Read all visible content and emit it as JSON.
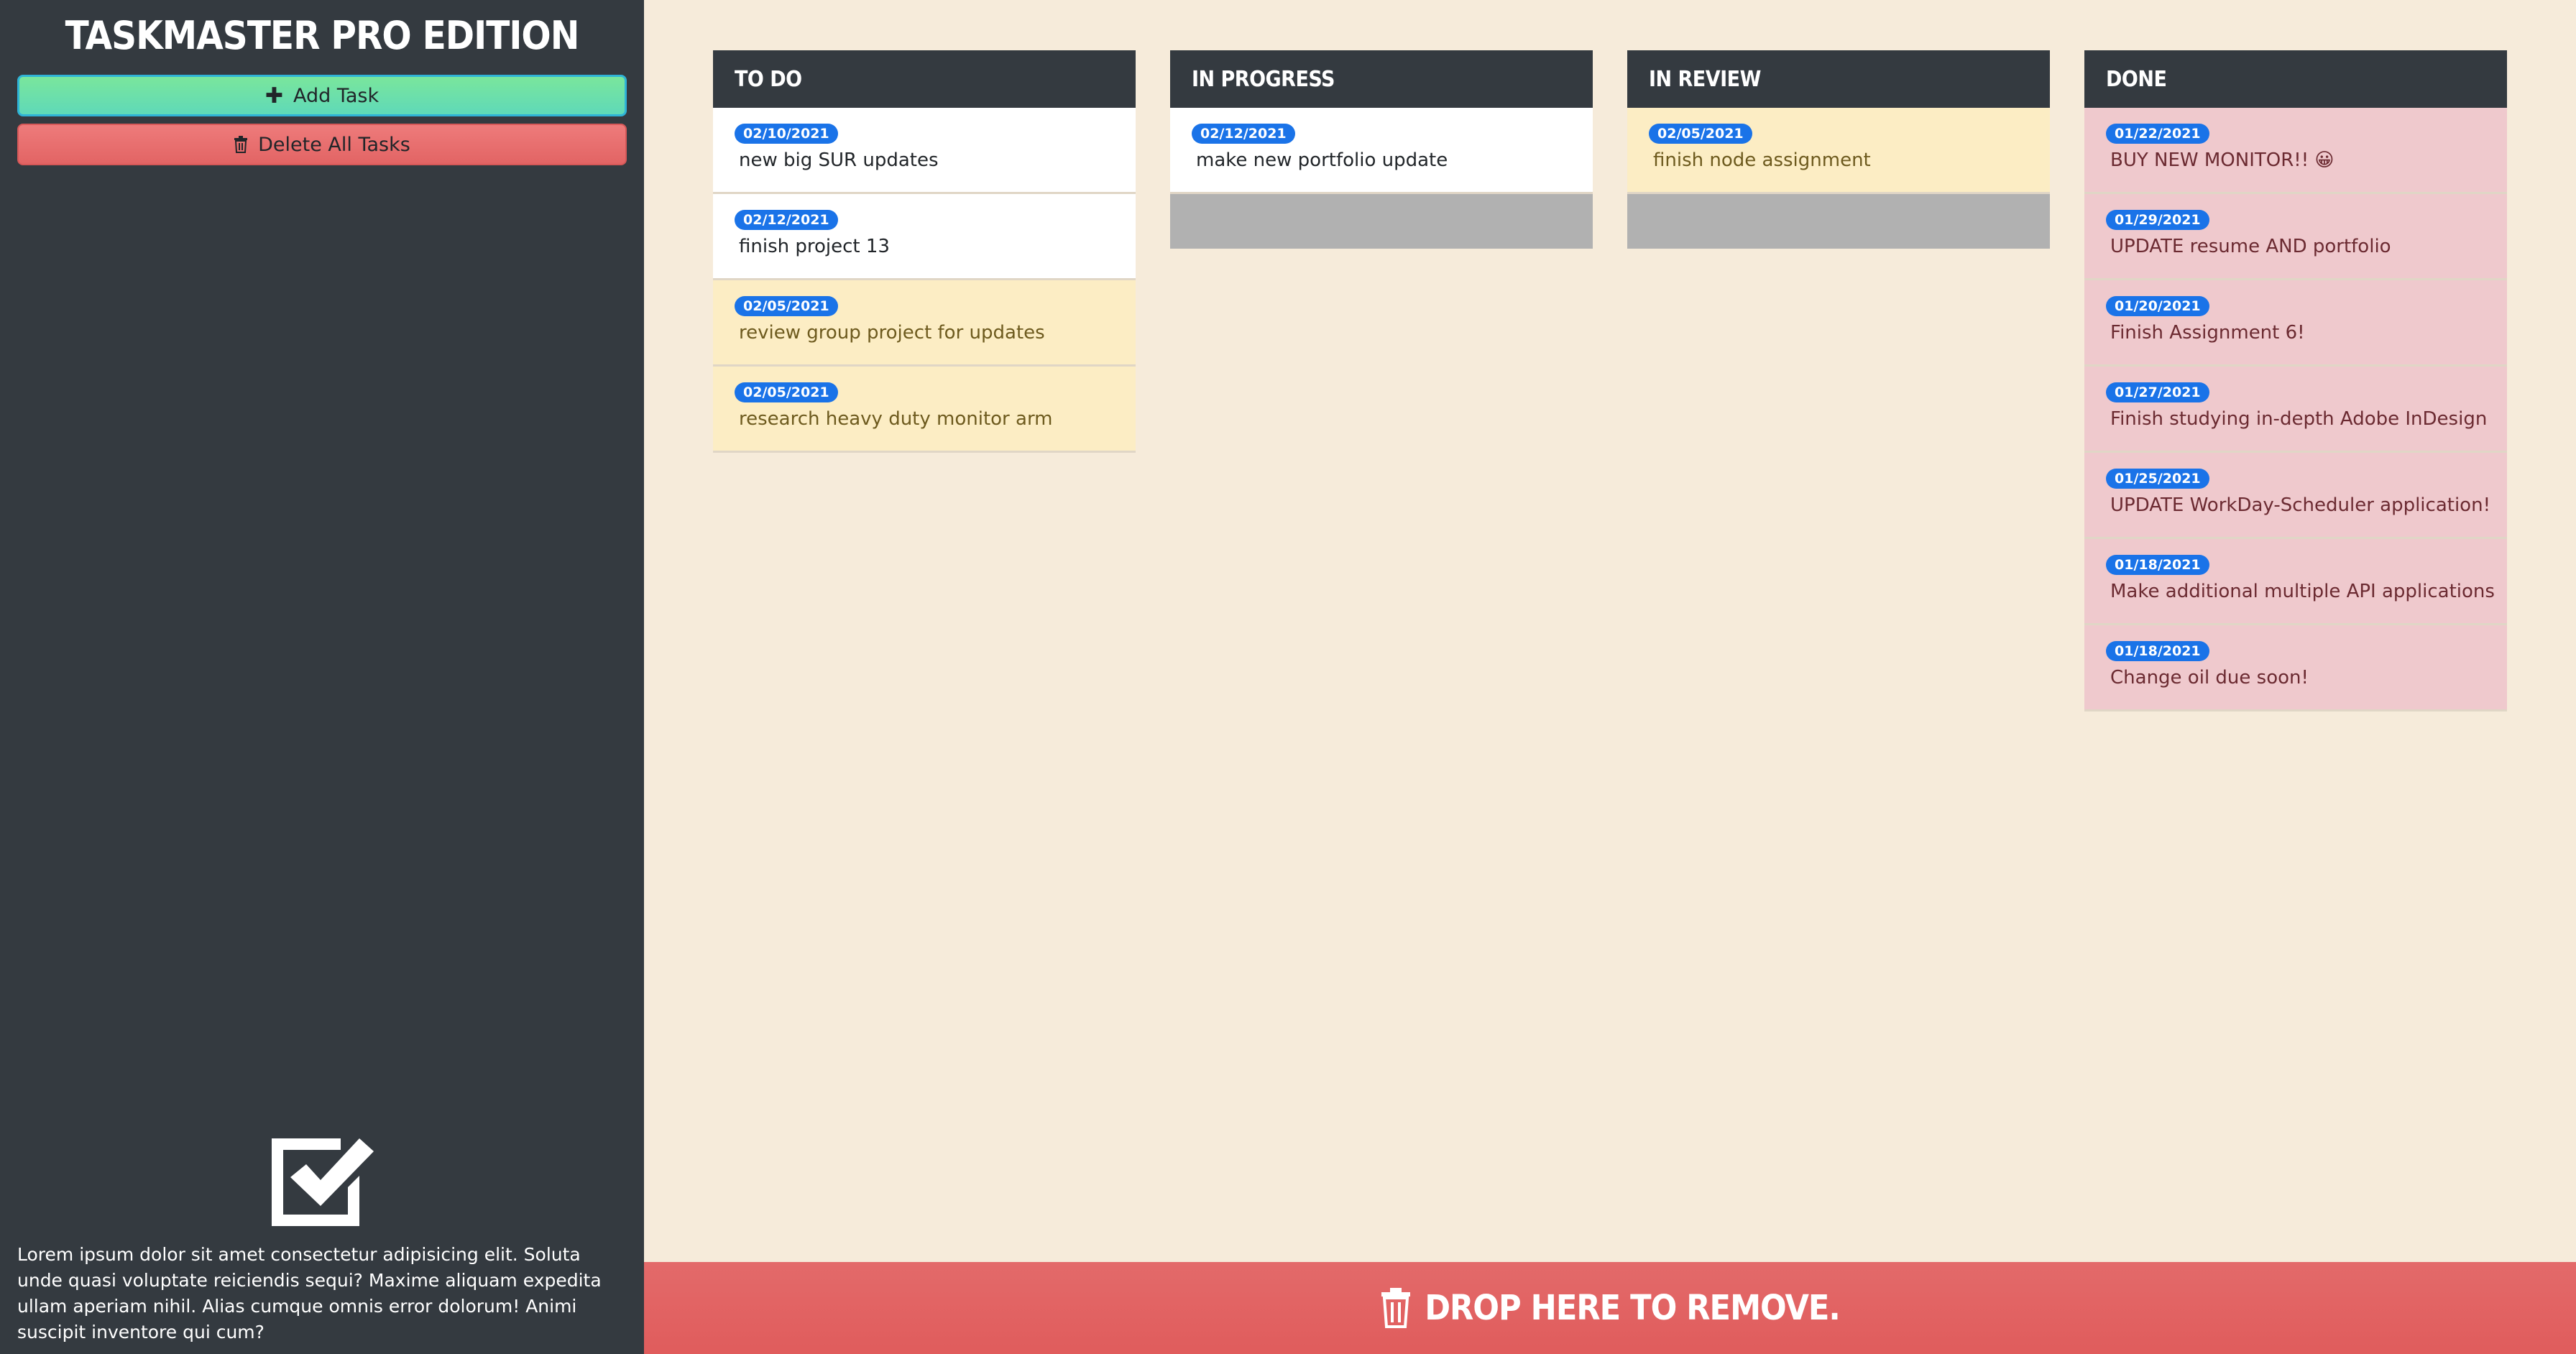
{
  "app": {
    "title": "TASKMASTER PRO EDITION",
    "add_label": "Add Task",
    "delete_label": "Delete All Tasks",
    "description": "Lorem ipsum dolor sit amet consectetur adipisicing elit. Soluta unde quasi voluptate reiciendis sequi? Maxime aliquam expedita ullam aperiam nihil. Alias cumque omnis error dolorum! Animi suscipit inventore qui cum?"
  },
  "icons": {
    "add": "plus-icon",
    "delete": "trash-icon",
    "logo": "check-square-icon",
    "drop": "trash-icon"
  },
  "colors": {
    "sidebar": "#343a40",
    "board": "#f6ebda",
    "add_button": "#6be0a8",
    "delete_button": "#e76c6c",
    "badge": "#1a73e8",
    "card_white": "#ffffff",
    "card_yellow": "#fcedc4",
    "card_pink": "#efc9cd",
    "trash_bar": "#e06060"
  },
  "columns": [
    {
      "title": "TO DO",
      "tasks": [
        {
          "date": "02/10/2021",
          "text": "new big SUR updates",
          "status": "white"
        },
        {
          "date": "02/12/2021",
          "text": "finish project 13",
          "status": "white"
        },
        {
          "date": "02/05/2021",
          "text": "review group project for updates",
          "status": "yellow"
        },
        {
          "date": "02/05/2021",
          "text": "research heavy duty monitor arm",
          "status": "yellow"
        }
      ]
    },
    {
      "title": "IN PROGRESS",
      "tasks": [
        {
          "date": "02/12/2021",
          "text": "make new portfolio update",
          "status": "white"
        }
      ]
    },
    {
      "title": "IN REVIEW",
      "tasks": [
        {
          "date": "02/05/2021",
          "text": "finish node assignment",
          "status": "yellow"
        }
      ]
    },
    {
      "title": "DONE",
      "tasks": [
        {
          "date": "01/22/2021",
          "text": "BUY NEW MONITOR!! 😀",
          "status": "pink"
        },
        {
          "date": "01/29/2021",
          "text": "UPDATE resume AND portfolio",
          "status": "pink"
        },
        {
          "date": "01/20/2021",
          "text": "Finish Assignment 6!",
          "status": "pink"
        },
        {
          "date": "01/27/2021",
          "text": "Finish studying in-depth Adobe InDesign",
          "status": "pink"
        },
        {
          "date": "01/25/2021",
          "text": "UPDATE WorkDay-Scheduler application!",
          "status": "pink"
        },
        {
          "date": "01/18/2021",
          "text": "Make additional multiple API applications",
          "status": "pink"
        },
        {
          "date": "01/18/2021",
          "text": "Change oil due soon!",
          "status": "pink"
        }
      ]
    }
  ],
  "trash": {
    "label": "DROP HERE TO REMOVE."
  }
}
